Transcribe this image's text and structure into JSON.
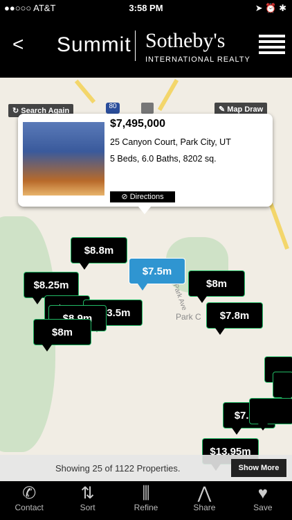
{
  "status": {
    "carrier": "●●○○○ AT&T",
    "time": "3:58 PM",
    "right": "➤ ⏰ ✱"
  },
  "header": {
    "title": "Summit",
    "brand": "Sotheby's",
    "brand_sub": "INTERNATIONAL REALTY"
  },
  "map": {
    "search_again": "Search Again",
    "map_draw": "Map Draw",
    "highway": "80",
    "place_label": "Park C",
    "street_label": "Park Ave"
  },
  "popup": {
    "price": "$7,495,000",
    "address": "25 Canyon Court, Park City, UT",
    "details": "5 Beds, 6.0 Baths, 8202 sq.",
    "directions": "Directions"
  },
  "pins": [
    "$8.8m",
    "$7.5m",
    "$8.25m",
    "$8m",
    "$13.",
    "$13.5m",
    "$8.9m",
    "$8m",
    "$7.8m",
    "$7.8m",
    "$13.95m"
  ],
  "bottom": {
    "showing": "Showing 25 of 1122 Properties.",
    "show_more": "Show More"
  },
  "tabs": [
    {
      "label": "Contact",
      "icon": "phone-icon"
    },
    {
      "label": "Sort",
      "icon": "sort-icon"
    },
    {
      "label": "Refine",
      "icon": "sliders-icon"
    },
    {
      "label": "Share",
      "icon": "share-icon"
    },
    {
      "label": "Save",
      "icon": "heart-icon"
    }
  ]
}
